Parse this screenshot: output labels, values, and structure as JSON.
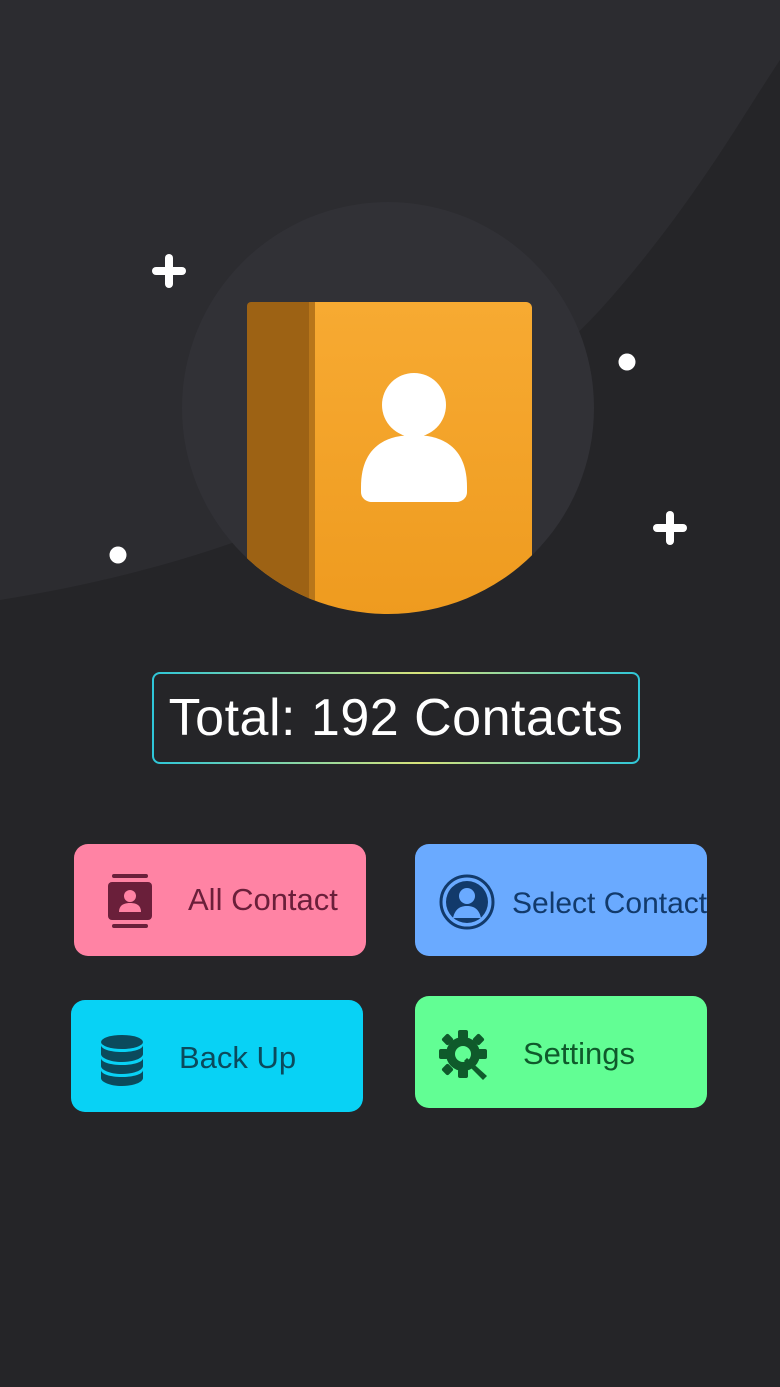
{
  "app": {
    "total_label": "Total: 192 Contacts"
  },
  "tiles": {
    "all_contact": {
      "label": "All Contact",
      "color": "#ff83a4",
      "text_color": "#6a1f3a",
      "icon": "contact-book-icon"
    },
    "select_contact": {
      "label": "Select Contact",
      "color": "#6aaaff",
      "text_color": "#123a6b",
      "icon": "user-circle-icon"
    },
    "back_up": {
      "label": "Back Up",
      "color": "#08d2f5",
      "text_color": "#0b4a5c",
      "icon": "database-icon"
    },
    "settings": {
      "label": "Settings",
      "color": "#62fe94",
      "text_color": "#0f5a2b",
      "icon": "gear-wrench-icon"
    }
  },
  "colors": {
    "background": "#252528",
    "hero_circle": "#313136",
    "book_cover": "#f5a428",
    "book_spine": "#9a5f12"
  }
}
